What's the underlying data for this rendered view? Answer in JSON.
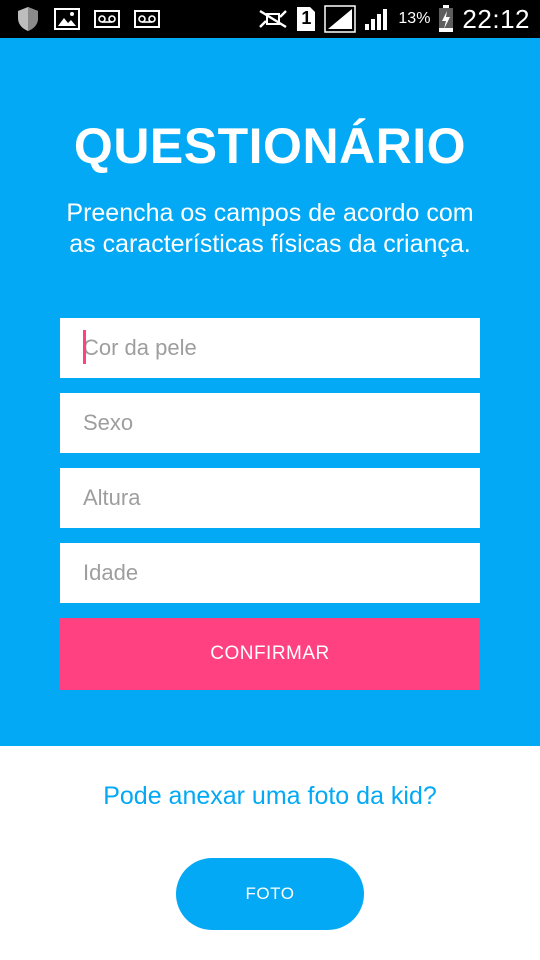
{
  "status_bar": {
    "left_icons": [
      "shield-icon",
      "image-icon",
      "voicemail-icon",
      "voicemail-icon"
    ],
    "sim_number": "1",
    "battery_percent": "13%",
    "time": "22:12"
  },
  "form": {
    "title": "QUESTIONÁRIO",
    "subtitle": "Preencha os campos de acordo com as características físicas da criança.",
    "fields": [
      {
        "placeholder": "Cor da pele",
        "value": ""
      },
      {
        "placeholder": "Sexo",
        "value": ""
      },
      {
        "placeholder": "Altura",
        "value": ""
      },
      {
        "placeholder": "Idade",
        "value": ""
      }
    ],
    "confirm_label": "CONFIRMAR"
  },
  "photo": {
    "question": "Pode anexar uma foto da kid?",
    "button_label": "FOTO"
  },
  "colors": {
    "primary": "#03a9f4",
    "accent": "#ff4081",
    "status_bar": "#000000"
  }
}
